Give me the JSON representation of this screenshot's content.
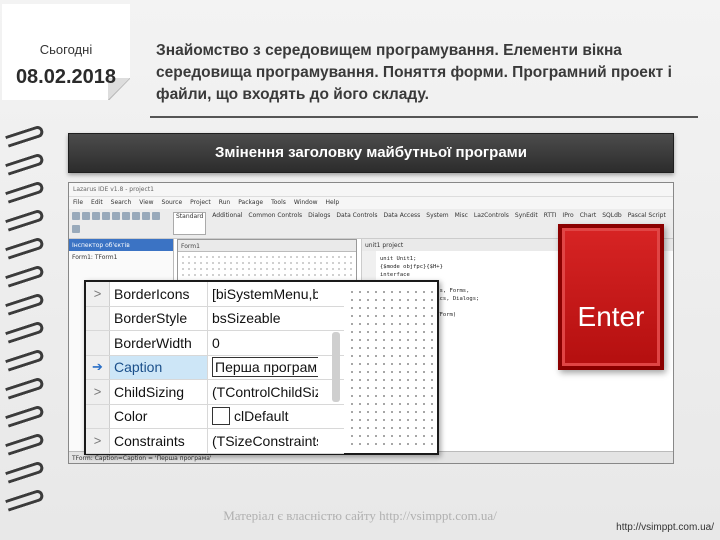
{
  "note": {
    "label": "Сьогодні",
    "date": "08.02.2018"
  },
  "title": "Знайомство з середовищем програмування. Елементи вікна середовища програмування. Поняття форми. Програмний проект і файли, що входять до його складу.",
  "banner": "Змінення заголовку майбутньої програми",
  "ide": {
    "window_title": "Lazarus IDE v1.8 - project1",
    "menu": [
      "File",
      "Edit",
      "Search",
      "View",
      "Source",
      "Project",
      "Run",
      "Package",
      "Tools",
      "Window",
      "Help"
    ],
    "palette_tabs": [
      "Standard",
      "Additional",
      "Common Controls",
      "Dialogs",
      "Data Controls",
      "Data Access",
      "System",
      "Misc",
      "LazControls",
      "SynEdit",
      "RTTI",
      "IPro",
      "Chart",
      "SQLdb",
      "Pascal Script"
    ],
    "inspector_title": "Інспектор об'єктів",
    "inspector_tree": [
      "Form1: TForm1"
    ],
    "form_title": "Form1",
    "editor_tabs": [
      "unit1",
      "project"
    ],
    "code_lines": [
      "unit Unit1;",
      "",
      "{$mode objfpc}{$H+}",
      "",
      "interface",
      "",
      "uses",
      "  Classes, SysUtils, Forms,",
      "  Controls, Graphics, Dialogs;",
      "",
      "type",
      "  TForm1 = class(TForm)",
      "  private",
      "  public",
      "  end;",
      "",
      "var",
      "  Form1: TForm1;",
      "",
      "implementation"
    ],
    "status": "TForm: Caption=Caption = 'Перша програма'"
  },
  "properties": [
    {
      "name": "BorderIcons",
      "value": "[biSystemMenu,bi",
      "marker": ">"
    },
    {
      "name": "BorderStyle",
      "value": "bsSizeable",
      "marker": ""
    },
    {
      "name": "BorderWidth",
      "value": "0",
      "marker": ""
    },
    {
      "name": "Caption",
      "value": "Перша програм",
      "marker": "➔"
    },
    {
      "name": "ChildSizing",
      "value": "(TControlChildSizi",
      "marker": ">"
    },
    {
      "name": "Color",
      "value": "clDefault",
      "marker": ""
    },
    {
      "name": "Constraints",
      "value": "(TSizeConstraints)",
      "marker": ">"
    }
  ],
  "enter_key": "Enter",
  "watermark": "Матеріал є власністю сайту http://vsimppt.com.ua/",
  "site": "http://vsimppt.com.ua/",
  "colors": {
    "accent": "#cc1a1a",
    "banner": "#3a3a3a",
    "selection": "#cde6f7"
  }
}
